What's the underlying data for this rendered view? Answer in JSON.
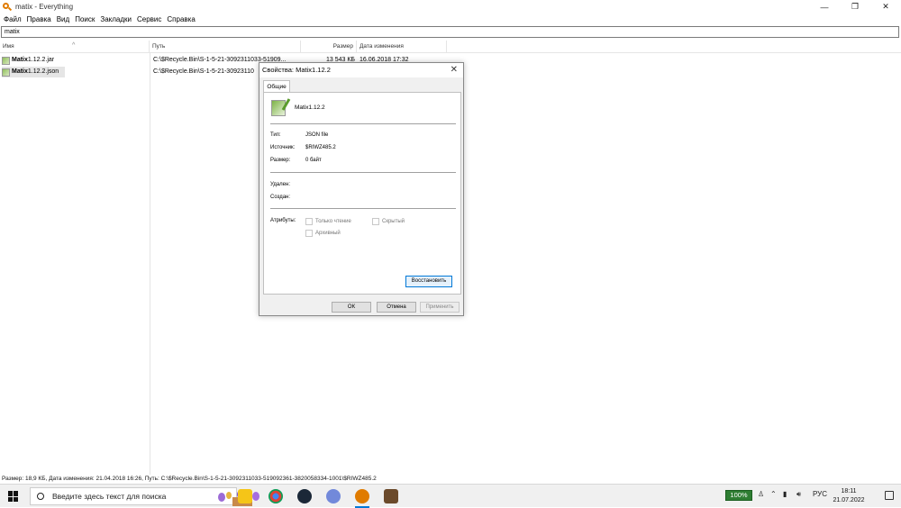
{
  "window": {
    "title": "matix - Everything",
    "minimize": "—",
    "maximize": "❐",
    "close": "✕"
  },
  "menu": [
    "Файл",
    "Правка",
    "Вид",
    "Поиск",
    "Закладки",
    "Сервис",
    "Справка"
  ],
  "search": {
    "value": "matix"
  },
  "columns": {
    "name": "Имя",
    "path": "Путь",
    "size": "Размер",
    "modified": "Дата изменения"
  },
  "rows": [
    {
      "name_bold": "Matix",
      "name_rest": "1.12.2.jar",
      "path": "C:\\$Recycle.Bin\\S-1-5-21-3092311033-51909...",
      "size": "13 543 КБ",
      "date": "16.06.2018 17:32"
    },
    {
      "name_bold": "Matix",
      "name_rest": "1.12.2.json",
      "path": "C:\\$Recycle.Bin\\S-1-5-21-30923110",
      "size": "",
      "date": ""
    }
  ],
  "status": "Размер: 18,9 КБ, Дата изменения: 21.04.2018 16:26, Путь: C:\\$Recycle.Bin\\S-1-5-21-3092311033-519092361-3820058334-1001\\$RIWZ485.2",
  "dialog": {
    "title": "Свойства: Matix1.12.2",
    "close": "✕",
    "tab": "Общие",
    "filename": "Matix1.12.2",
    "type_label": "Тип:",
    "type_value": "JSON file",
    "source_label": "Источник:",
    "source_value": "$RIWZ485.2",
    "size_label": "Размер:",
    "size_value": "0 байт",
    "deleted_label": "Удален:",
    "created_label": "Создан:",
    "attrs_label": "Атрибуты:",
    "readonly": "Только чтение",
    "hidden": "Скрытый",
    "archive": "Архивный",
    "restore": "Восстановить",
    "ok": "ОК",
    "cancel": "Отмена",
    "apply": "Применить"
  },
  "taskbar": {
    "search_placeholder": "Введите здесь текст для поиска",
    "battery": "100%",
    "lang": "РУС",
    "time": "18:11",
    "date": "21.07.2022",
    "icons": [
      "start-icon",
      "search-icon",
      "file-explorer-icon",
      "chrome-icon",
      "steam-icon",
      "discord-icon",
      "everything-icon",
      "minecraft-icon"
    ]
  },
  "colors": {
    "accent": "#0078d7",
    "everything_orange": "#e07b00",
    "battery_green": "#2e7d32"
  }
}
